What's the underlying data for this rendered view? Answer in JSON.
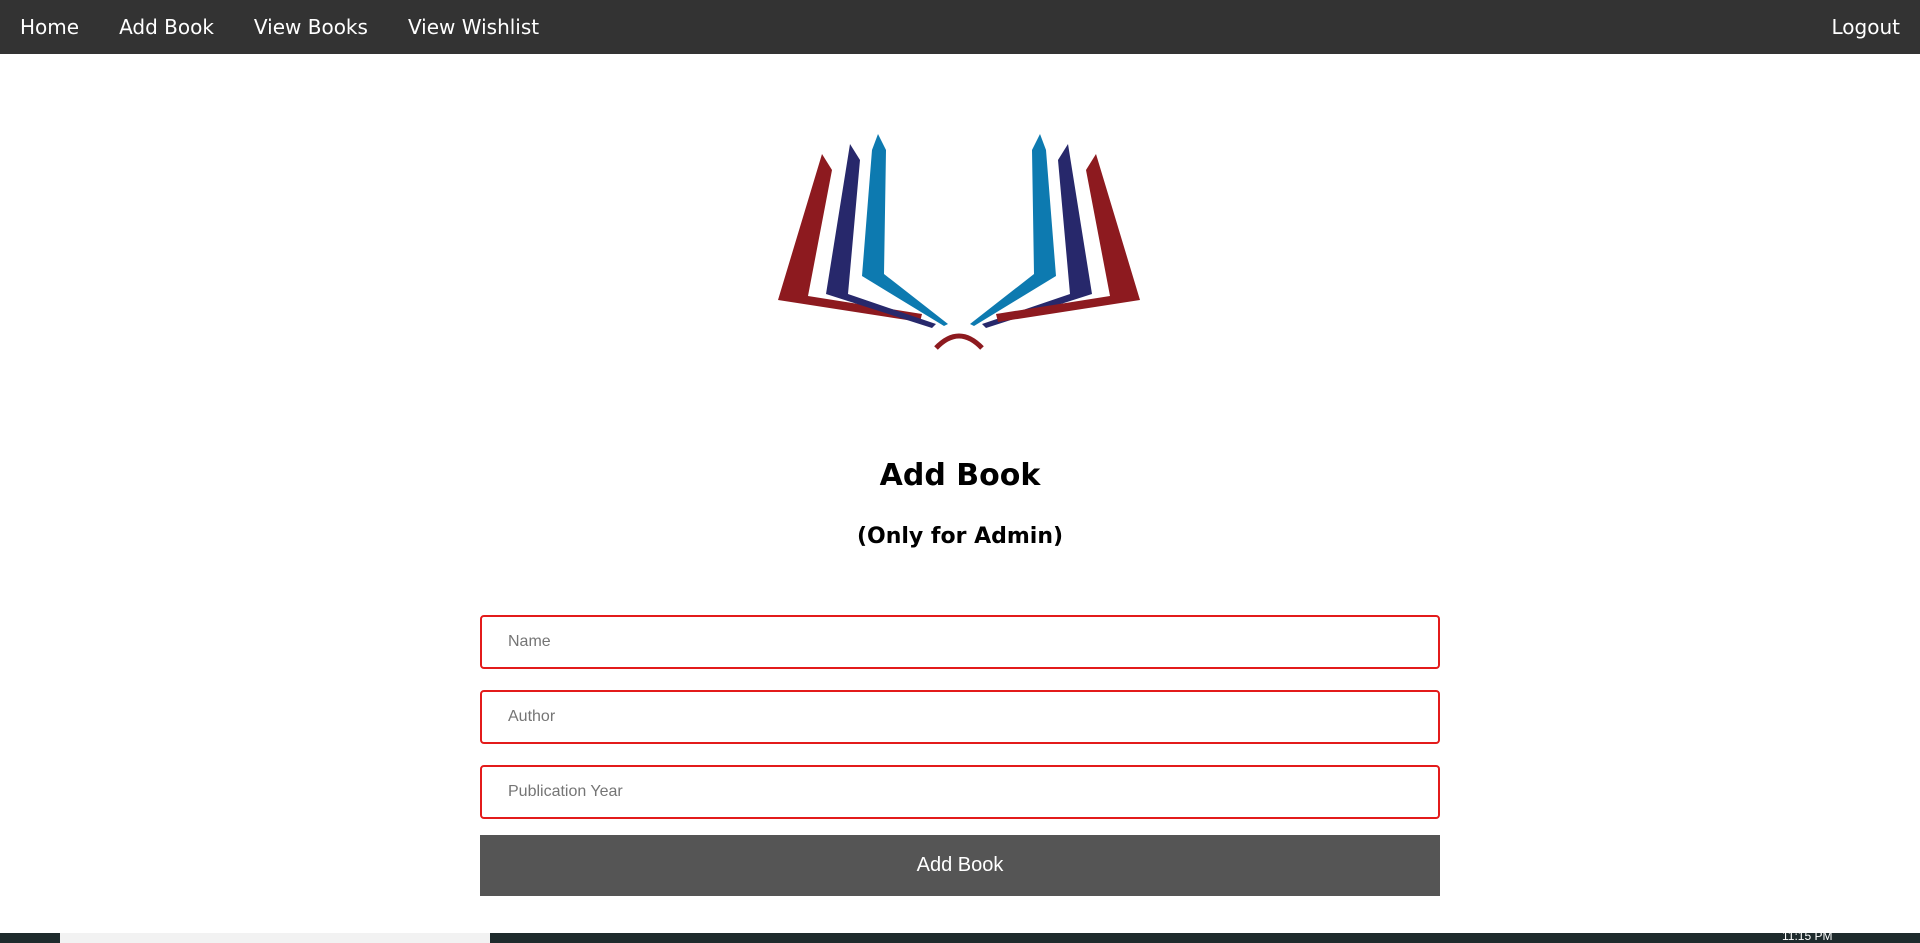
{
  "nav": {
    "home": "Home",
    "add_book": "Add Book",
    "view_books": "View Books",
    "view_wishlist": "View Wishlist",
    "logout": "Logout"
  },
  "logo": {
    "icon": "open-book-logo",
    "colors": {
      "red": "#8d1a1f",
      "navy": "#27286b",
      "blue": "#0d7ab0"
    }
  },
  "page": {
    "title": "Add Book",
    "subtitle": "(Only for Admin)"
  },
  "form": {
    "name_placeholder": "Name",
    "name_value": "",
    "author_placeholder": "Author",
    "author_value": "",
    "year_placeholder": "Publication Year",
    "year_value": "",
    "submit_label": "Add Book"
  },
  "colors": {
    "navbar_bg": "#333333",
    "field_border": "#e31b1b",
    "button_bg": "#555555"
  },
  "taskbar": {
    "clock": "11:15 PM"
  }
}
